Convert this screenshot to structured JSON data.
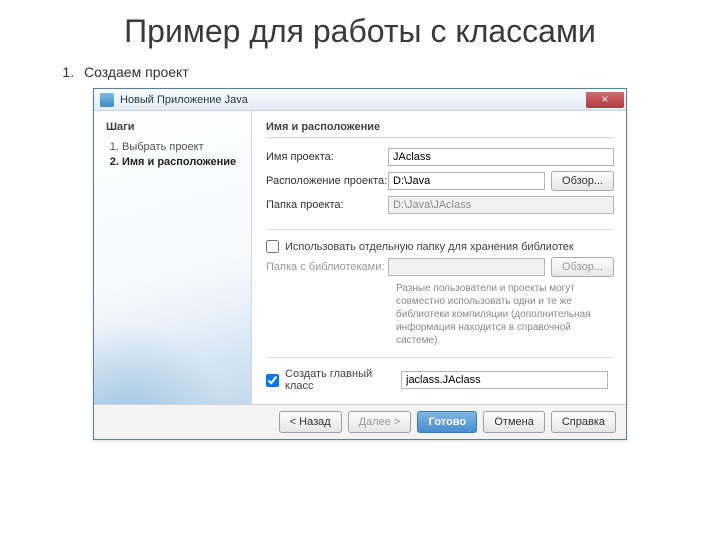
{
  "slide": {
    "title": "Пример для работы с классами",
    "step_number": "1.",
    "step_text": "Создаем проект"
  },
  "dialog": {
    "title": "Новый Приложение Java",
    "close": "×",
    "steps_header": "Шаги",
    "steps": [
      {
        "label": "Выбрать проект"
      },
      {
        "label": "Имя и расположение"
      }
    ],
    "section_title": "Имя и расположение",
    "project_name_label": "Имя проекта:",
    "project_name_value": "JAclass",
    "project_location_label": "Расположение проекта:",
    "project_location_value": "D:\\Java",
    "browse_label": "Обзор...",
    "project_folder_label": "Папка проекта:",
    "project_folder_value": "D:\\Java\\JAclass",
    "use_lib_folder_label": "Использовать отдельную папку для хранения библиотек",
    "lib_folder_label": "Папка с библиотеками:",
    "lib_folder_value": "",
    "lib_help_text": "Разные пользователи и проекты могут совместно использовать одни и те же библиотеки компиляции (дополнительная информация находится в справочной системе).",
    "create_main_class_label": "Создать главный класс",
    "main_class_value": "jaclass.JAclass",
    "buttons": {
      "back": "< Назад",
      "next": "Далее >",
      "finish": "Готово",
      "cancel": "Отмена",
      "help": "Справка"
    }
  }
}
